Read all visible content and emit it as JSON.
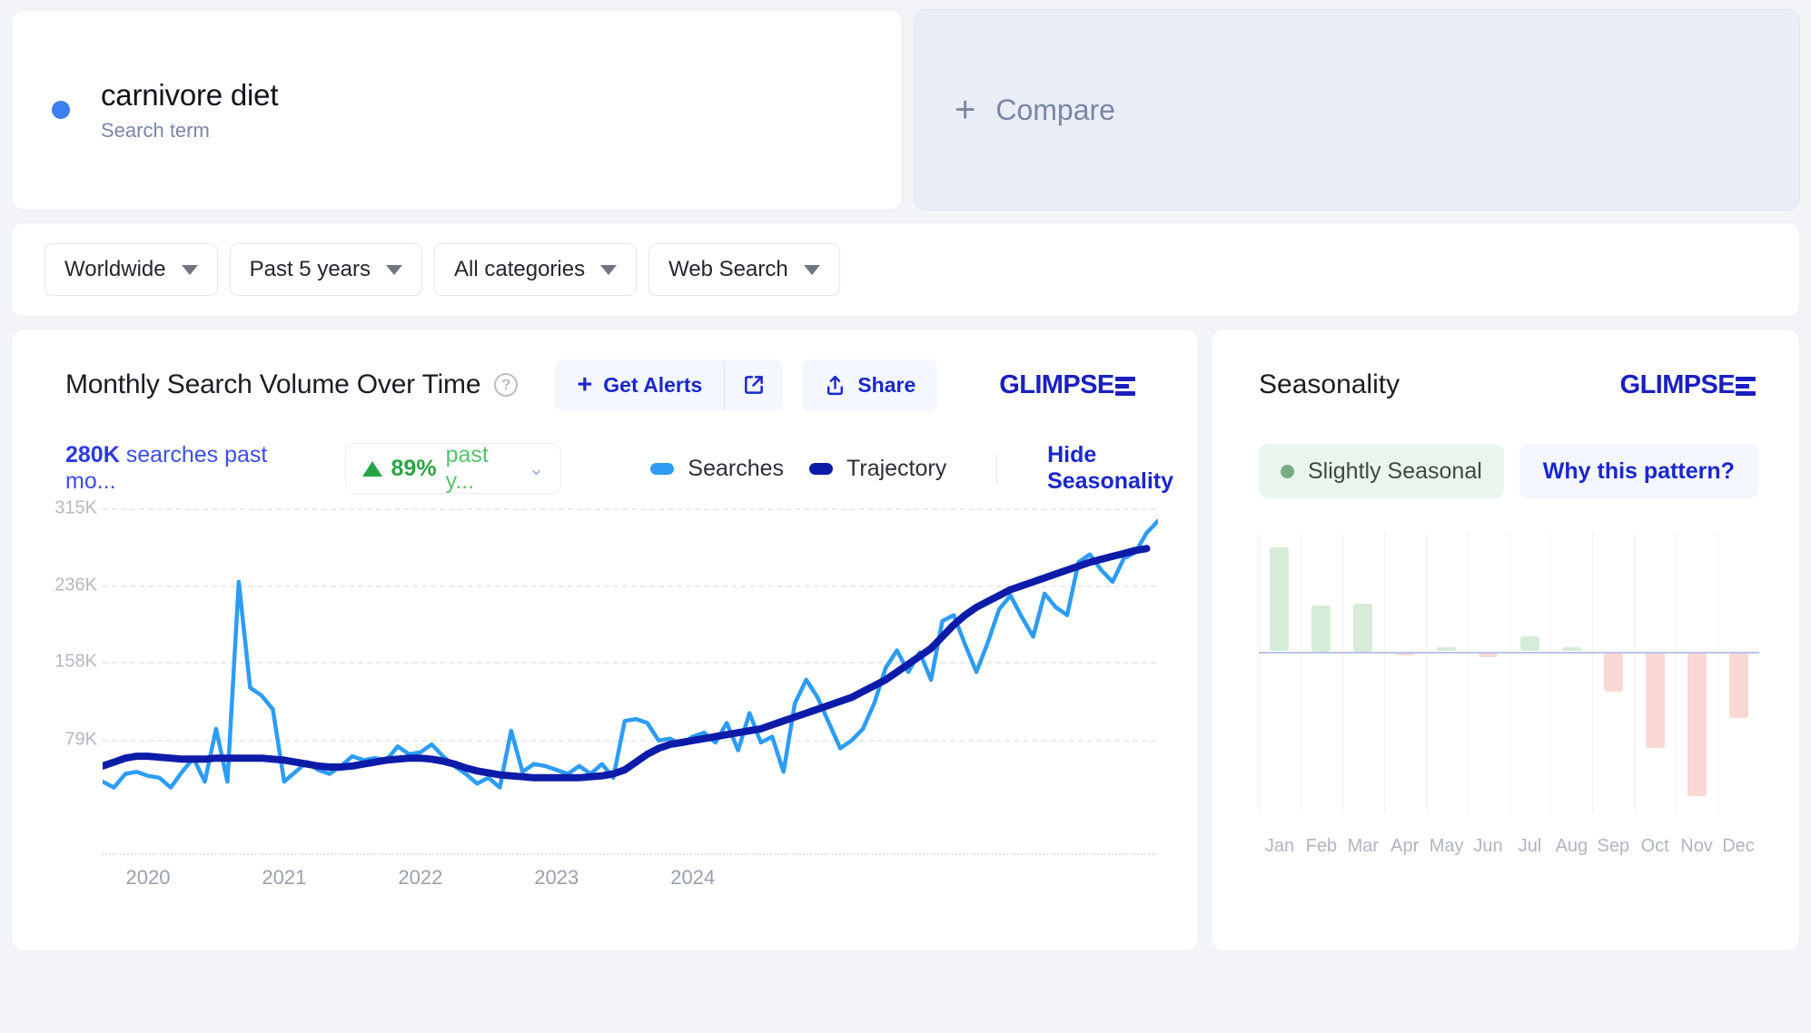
{
  "term": {
    "label": "carnivore diet",
    "subtitle": "Search term",
    "dot_color": "#3b7ff0"
  },
  "compare": {
    "label": "Compare",
    "plus": "+"
  },
  "filters": [
    {
      "name": "region",
      "label": "Worldwide"
    },
    {
      "name": "timeframe",
      "label": "Past 5 years"
    },
    {
      "name": "category",
      "label": "All categories"
    },
    {
      "name": "search-type",
      "label": "Web Search"
    }
  ],
  "chart_panel": {
    "title": "Monthly Search Volume Over Time",
    "help_icon": "?",
    "get_alerts_label": "Get Alerts",
    "get_alerts_plus": "+",
    "open_external_icon": "external-link-icon",
    "share_label": "Share",
    "brand": "GLIMPSE",
    "stat_value": "280K",
    "stat_label": "searches past mo...",
    "delta_value": "89%",
    "delta_label": "past y...",
    "delta_chevron": "⌄",
    "legend": [
      {
        "label": "Searches",
        "color": "#2d9cf5"
      },
      {
        "label": "Trajectory",
        "color": "#0d1ca8"
      }
    ],
    "hide_seasonality_label": "Hide Seasonality"
  },
  "seasonality_panel": {
    "title": "Seasonality",
    "brand": "GLIMPSE",
    "badge_label": "Slightly Seasonal",
    "badge_color": "#76ab84",
    "why_label": "Why this pattern?"
  },
  "chart_data": [
    {
      "type": "line",
      "title": "Monthly Search Volume Over Time",
      "xlabel": "",
      "ylabel": "",
      "ylim": [
        0,
        315000
      ],
      "grid": true,
      "legend_position": "top",
      "y_ticks": [
        {
          "label": "79K",
          "value": 79000
        },
        {
          "label": "158K",
          "value": 158000
        },
        {
          "label": "236K",
          "value": 236000
        },
        {
          "label": "315K",
          "value": 315000
        }
      ],
      "x_ticks": [
        {
          "label": "2020",
          "index": 4
        },
        {
          "label": "2021",
          "index": 16
        },
        {
          "label": "2022",
          "index": 28
        },
        {
          "label": "2023",
          "index": 40
        },
        {
          "label": "2024",
          "index": 52
        }
      ],
      "series": [
        {
          "name": "Searches",
          "color": "#2d9cf5",
          "values": [
            36000,
            30000,
            44000,
            46000,
            42000,
            40000,
            30000,
            46000,
            60000,
            36000,
            90000,
            36000,
            240000,
            132000,
            124000,
            110000,
            36000,
            46000,
            56000,
            48000,
            44000,
            52000,
            62000,
            58000,
            60000,
            58000,
            72000,
            64000,
            66000,
            74000,
            62000,
            52000,
            44000,
            34000,
            40000,
            30000,
            88000,
            46000,
            54000,
            52000,
            48000,
            44000,
            52000,
            44000,
            54000,
            40000,
            98000,
            100000,
            96000,
            78000,
            80000,
            74000,
            82000,
            86000,
            76000,
            96000,
            68000,
            106000,
            76000,
            82000,
            46000,
            116000,
            140000,
            122000,
            96000,
            70000,
            78000,
            90000,
            116000,
            152000,
            170000,
            148000,
            168000,
            140000,
            200000,
            206000,
            176000,
            148000,
            178000,
            212000,
            226000,
            204000,
            184000,
            228000,
            214000,
            206000,
            260000,
            268000,
            252000,
            240000,
            264000,
            270000,
            290000,
            302000
          ]
        },
        {
          "name": "Trajectory",
          "color": "#0d1ca8",
          "values": [
            52000,
            56000,
            60000,
            62000,
            62000,
            61000,
            60000,
            59000,
            59000,
            59000,
            60000,
            60000,
            60000,
            60000,
            60000,
            59000,
            58000,
            56000,
            54000,
            52000,
            51000,
            51000,
            52000,
            54000,
            56000,
            58000,
            59000,
            60000,
            60000,
            59000,
            57000,
            54000,
            50000,
            47000,
            45000,
            43000,
            42000,
            41000,
            40000,
            40000,
            40000,
            40000,
            40000,
            41000,
            42000,
            44000,
            48000,
            56000,
            64000,
            70000,
            74000,
            76000,
            78000,
            80000,
            82000,
            84000,
            86000,
            88000,
            90000,
            94000,
            98000,
            102000,
            106000,
            110000,
            114000,
            118000,
            122000,
            128000,
            134000,
            140000,
            148000,
            156000,
            164000,
            172000,
            184000,
            196000,
            206000,
            214000,
            220000,
            226000,
            232000,
            236000,
            240000,
            244000,
            248000,
            252000,
            256000,
            260000,
            263000,
            266000,
            269000,
            272000,
            274000
          ]
        }
      ]
    },
    {
      "type": "bar",
      "title": "Seasonality",
      "xlabel": "",
      "ylabel": "",
      "grid": true,
      "categories": [
        "Jan",
        "Feb",
        "Mar",
        "Apr",
        "May",
        "Jun",
        "Jul",
        "Aug",
        "Sep",
        "Oct",
        "Nov",
        "Dec"
      ],
      "values": [
        56,
        25,
        26,
        -2,
        2,
        -3,
        8,
        2,
        -22,
        -52,
        -78,
        -36
      ],
      "ylim": [
        -88,
        64
      ],
      "positive_color": "#d6ecd9",
      "negative_color": "#fbd7d5"
    }
  ]
}
